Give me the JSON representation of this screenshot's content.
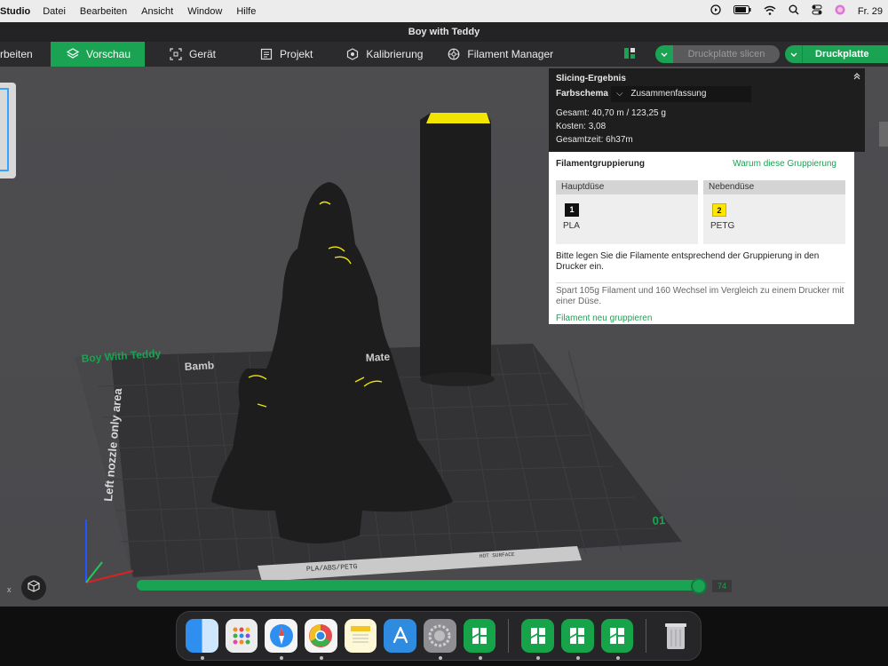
{
  "menubar": {
    "app_name": "Studio",
    "items": [
      "Datei",
      "Bearbeiten",
      "Ansicht",
      "Window",
      "Hilfe"
    ],
    "clock": "Fr. 29"
  },
  "window": {
    "title": "Boy with Teddy"
  },
  "toolbar": {
    "tabs": [
      {
        "label": "rbeiten"
      },
      {
        "label": "Vorschau"
      },
      {
        "label": "Gerät"
      },
      {
        "label": "Projekt"
      },
      {
        "label": "Kalibrierung"
      },
      {
        "label": "Filament Manager"
      }
    ],
    "slice_label": "Druckplatte slicen",
    "print_label": "Druckplatte druck"
  },
  "slicing": {
    "title": "Slicing-Ergebnis",
    "scheme_label": "Farbschema",
    "scheme_value": "Zusammenfassung",
    "total": "Gesamt:  40,70 m / 123,25 g",
    "cost": "Kosten:  3,08",
    "time": "Gesamtzeit:  6h37m"
  },
  "grouping": {
    "title": "Filamentgruppierung",
    "why_link": "Warum diese Gruppierung",
    "main_nozzle": {
      "label": "Hauptdüse",
      "slot": "1",
      "filament": "PLA",
      "color": "#111111"
    },
    "aux_nozzle": {
      "label": "Nebendüse",
      "slot": "2",
      "filament": "PETG",
      "color": "#ffe600"
    },
    "instruction": "Bitte legen Sie die Filamente entsprechend der Gruppierung in den Drucker ein.",
    "savings": "Spart 105g Filament und 160 Wechsel im Vergleich zu einem Drucker mit einer Düse.",
    "regroup_link": "Filament neu gruppieren"
  },
  "scene": {
    "model_label": "Boy With Teddy",
    "plate_brand": "Bamb",
    "plate_right": "Mate",
    "left_zone": "Left nozzle only area",
    "plate_number": "01",
    "plate_strip": "PLA/ABS/PETG",
    "plate_strip2": "HOT SURFACE"
  },
  "progress": {
    "percent": 100,
    "value": "74",
    "axis_x": "x"
  },
  "colors": {
    "accent": "#1aa352",
    "yellow": "#f2e600"
  },
  "dock": [
    "finder-icon",
    "launchpad-icon",
    "safari-icon",
    "chrome-icon",
    "notes-icon",
    "appstore-icon",
    "settings-icon",
    "bambu-icon",
    "bambu-icon",
    "bambu-icon",
    "bambu-icon",
    "trash-icon"
  ]
}
